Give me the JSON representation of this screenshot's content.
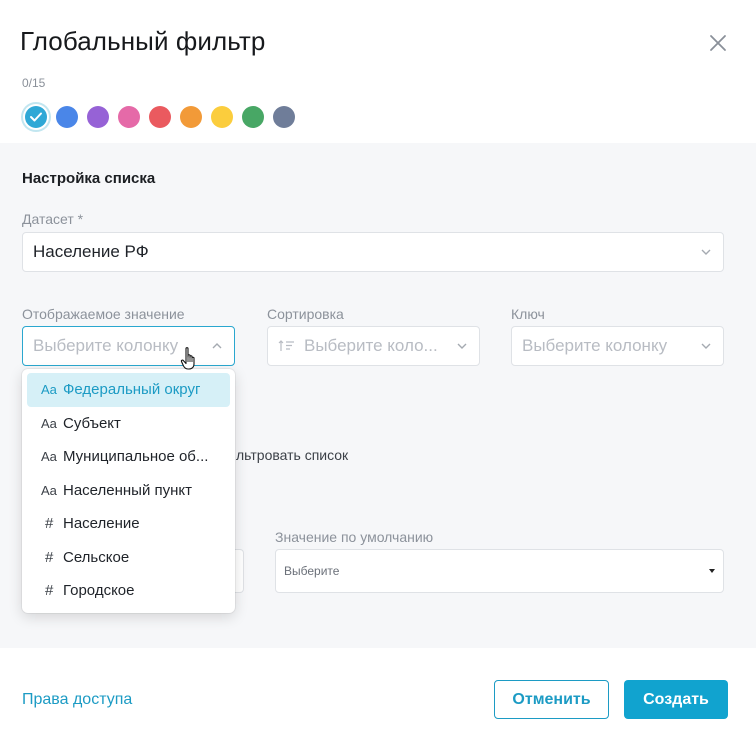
{
  "dialog": {
    "title": "Глобальный фильтр",
    "counter": "0/15"
  },
  "swatches": [
    {
      "color": "#2fa8d6",
      "selected": true
    },
    {
      "color": "#4a86e8",
      "selected": false
    },
    {
      "color": "#9662d6",
      "selected": false
    },
    {
      "color": "#e56aa8",
      "selected": false
    },
    {
      "color": "#ea5a5f",
      "selected": false
    },
    {
      "color": "#f29a38",
      "selected": false
    },
    {
      "color": "#fbcd3d",
      "selected": false
    },
    {
      "color": "#48a765",
      "selected": false
    },
    {
      "color": "#6f7d99",
      "selected": false
    }
  ],
  "list_settings": {
    "section_title": "Настройка списка",
    "dataset_label": "Датасет",
    "required_mark": "*",
    "dataset_value": "Население РФ",
    "display_label": "Отображаемое значение",
    "display_placeholder": "Выберите колонку",
    "sort_label": "Сортировка",
    "sort_placeholder": "Выберите коло...",
    "key_label": "Ключ",
    "key_placeholder": "Выберите колонку"
  },
  "dropdown": {
    "items": [
      {
        "icon": "Aa",
        "label": "Федеральный округ",
        "active": true
      },
      {
        "icon": "Aa",
        "label": "Субъект",
        "active": false
      },
      {
        "icon": "Aa",
        "label": "Муниципальное об...",
        "active": false
      },
      {
        "icon": "Aa",
        "label": "Населенный пункт",
        "active": false
      },
      {
        "icon": "#",
        "label": "Население",
        "active": false
      },
      {
        "icon": "#",
        "label": "Сельское",
        "active": false
      },
      {
        "icon": "#",
        "label": "Городское",
        "active": false
      }
    ]
  },
  "filter_text": "льтровать список",
  "default_value": {
    "label": "Значение по умолчанию",
    "placeholder": "Выберите"
  },
  "footer": {
    "access_link": "Права доступа",
    "cancel_label": "Отменить",
    "create_label": "Создать"
  },
  "colors": {
    "accent": "#1c9bc4",
    "primary_button": "#11a3cf",
    "body_background": "#f6f7f9"
  }
}
